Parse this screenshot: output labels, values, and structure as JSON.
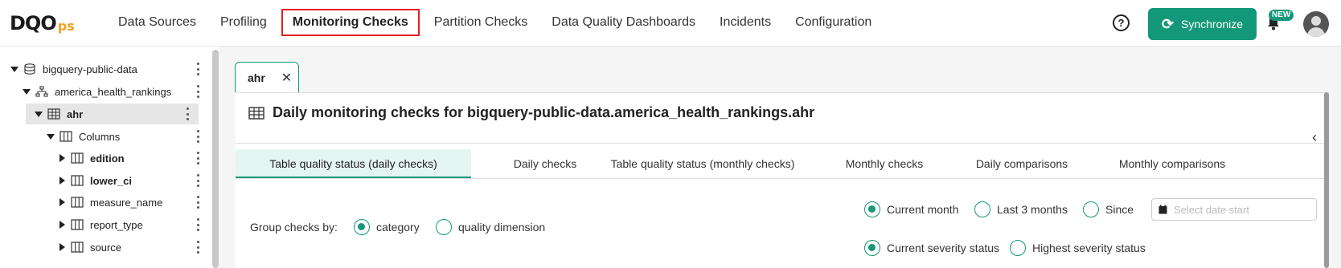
{
  "logo": {
    "text_main": "DQO",
    "text_accent": "ps"
  },
  "nav": {
    "items": [
      {
        "label": "Data Sources"
      },
      {
        "label": "Profiling"
      },
      {
        "label": "Monitoring Checks",
        "active": true
      },
      {
        "label": "Partition Checks"
      },
      {
        "label": "Data Quality Dashboards"
      },
      {
        "label": "Incidents"
      },
      {
        "label": "Configuration"
      }
    ],
    "help_icon": "question-circle-icon",
    "sync_label": "Synchronize",
    "sync_icon": "sync-icon",
    "notification_icon": "bell-icon",
    "new_badge": "NEW",
    "avatar_icon": "user-avatar-icon"
  },
  "tree": {
    "items": [
      {
        "label": "bigquery-public-data",
        "icon": "database-icon",
        "expanded": true
      },
      {
        "label": "america_health_rankings",
        "icon": "schema-icon",
        "expanded": true
      },
      {
        "label": "ahr",
        "icon": "table-icon",
        "expanded": true,
        "selected": true
      },
      {
        "label": "Columns",
        "icon": "columns-icon",
        "expanded": true
      },
      {
        "label": "edition",
        "icon": "column-icon",
        "bold": true
      },
      {
        "label": "lower_ci",
        "icon": "column-icon",
        "bold": true
      },
      {
        "label": "measure_name",
        "icon": "column-icon"
      },
      {
        "label": "report_type",
        "icon": "column-icon"
      },
      {
        "label": "source",
        "icon": "column-icon"
      }
    ]
  },
  "tabs": {
    "open": [
      {
        "label": "ahr",
        "close": "✕"
      }
    ]
  },
  "panel": {
    "title": "Daily monitoring checks for bigquery-public-data.america_health_rankings.ahr",
    "collapse_icon": "chevron-left-icon",
    "subtabs": [
      {
        "label": "Table quality status (daily checks)",
        "active": true
      },
      {
        "label": "Daily checks"
      },
      {
        "label": "Table quality status (monthly checks)"
      },
      {
        "label": "Monthly checks"
      },
      {
        "label": "Daily comparisons"
      },
      {
        "label": "Monthly comparisons"
      }
    ],
    "group_by": {
      "label": "Group checks by:",
      "options": [
        {
          "label": "category",
          "checked": true
        },
        {
          "label": "quality dimension",
          "checked": false
        }
      ]
    },
    "period": {
      "options": [
        {
          "label": "Current month",
          "checked": true
        },
        {
          "label": "Last 3 months",
          "checked": false
        },
        {
          "label": "Since",
          "checked": false
        }
      ],
      "date_placeholder": "Select date start"
    },
    "severity": {
      "options": [
        {
          "label": "Current severity status",
          "checked": true
        },
        {
          "label": "Highest severity status",
          "checked": false
        }
      ]
    }
  },
  "colors": {
    "accent": "#14987a",
    "active_nav_border": "#e02020",
    "logo_accent": "#f0a020"
  }
}
